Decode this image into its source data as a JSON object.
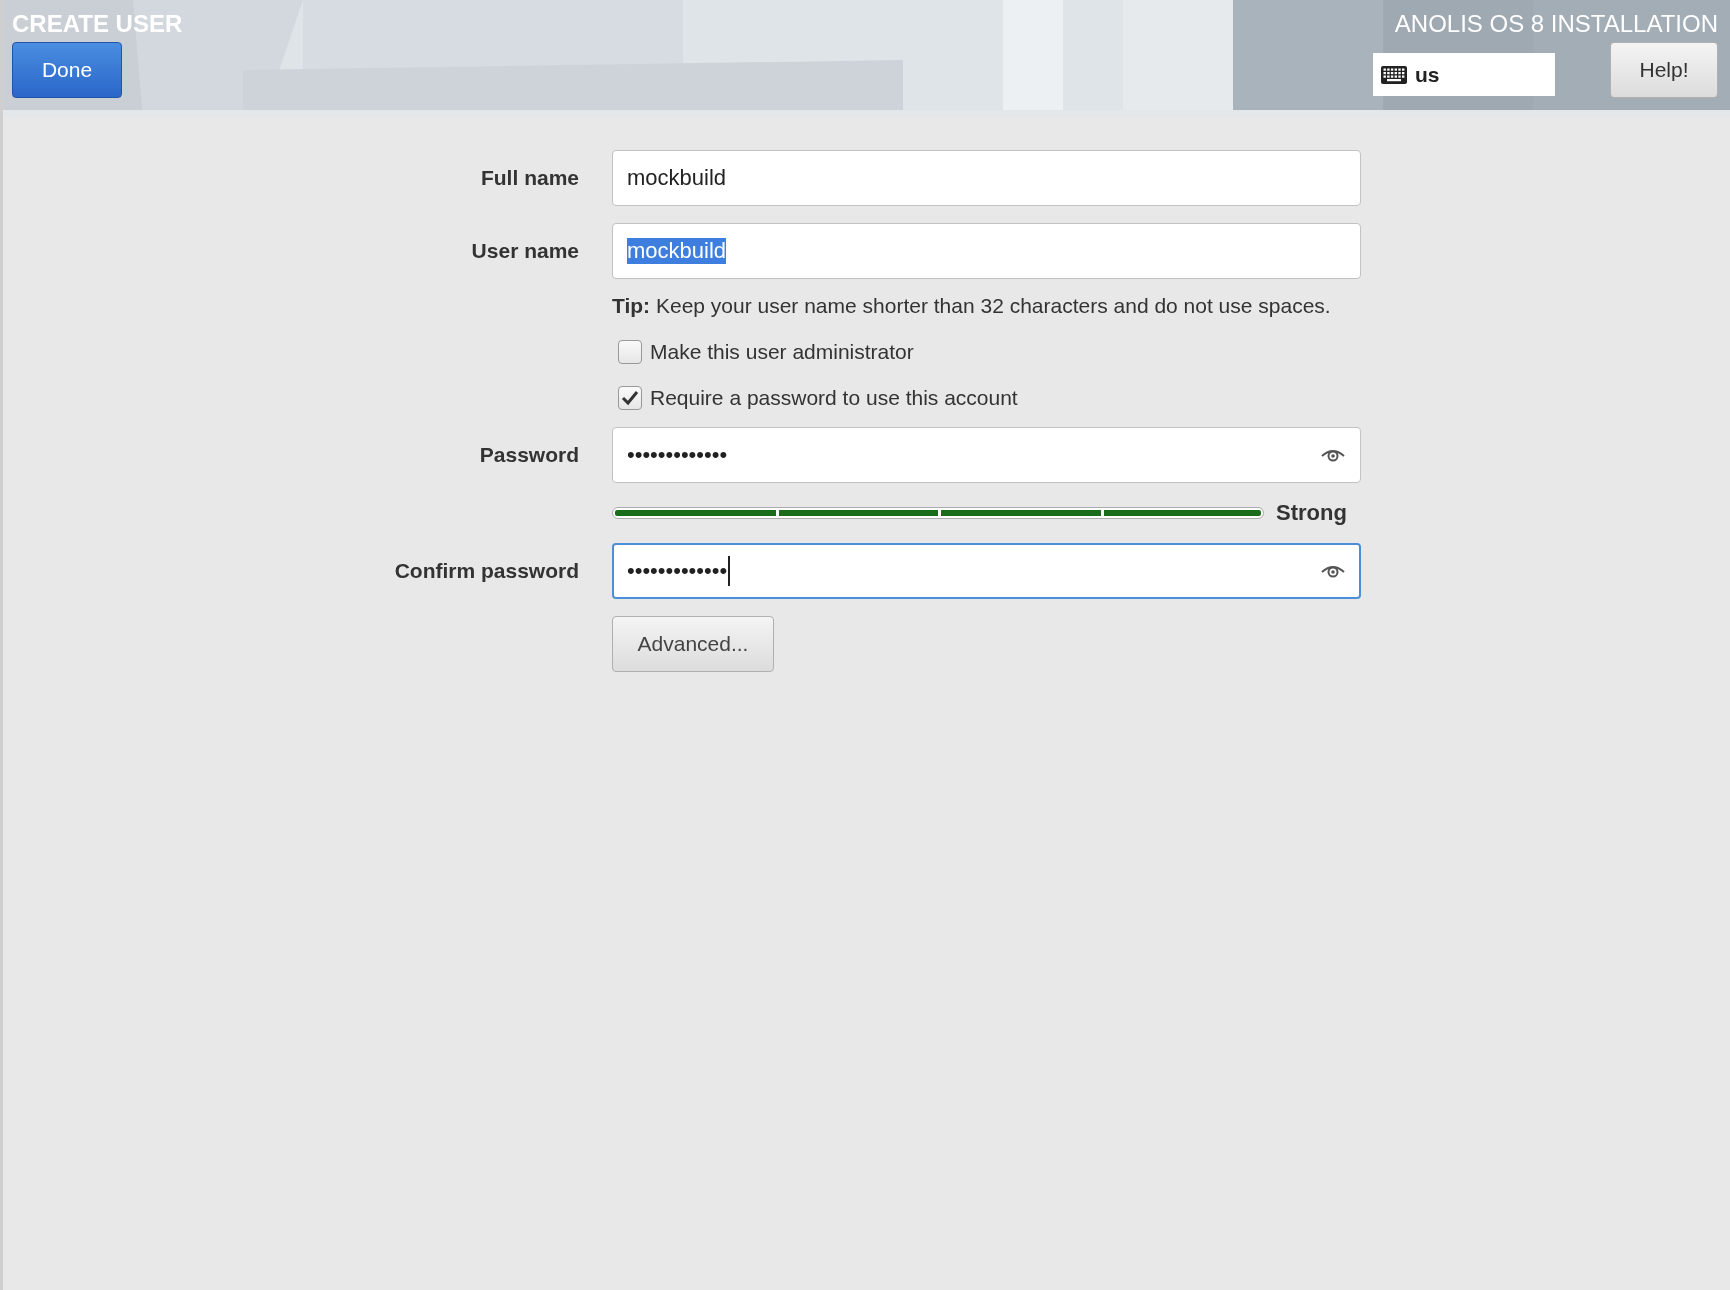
{
  "header": {
    "title": "CREATE USER",
    "product": "ANOLIS OS 8 INSTALLATION",
    "done_button": "Done",
    "help_button": "Help!",
    "keyboard_layout": "us"
  },
  "form": {
    "fields": [
      {
        "label": "Full name",
        "value": "mockbuild",
        "text_selected": false,
        "focused": false,
        "reveal_icon": false
      },
      {
        "label": "User name",
        "value": "mockbuild",
        "text_selected": true,
        "focused": false,
        "reveal_icon": false
      }
    ],
    "tip": "**Tip:** Keep your user name shorter than 32 characters and do not use spaces.",
    "checkboxes": [
      {
        "label": "Make this user administrator",
        "checked": false
      },
      {
        "label": "Require a password to use this account",
        "checked": true
      }
    ],
    "password": {
      "label": "Password",
      "value": "•••••••••••••",
      "text_selected": false,
      "focused": false,
      "reveal_icon": true
    },
    "strength": {
      "level": 1,
      "label": "Strong"
    },
    "confirm": {
      "label": "Confirm password",
      "value": "•••••••••••••",
      "text_selected": false,
      "focused": true,
      "reveal_icon": true
    },
    "advanced_button": "Advanced..."
  }
}
